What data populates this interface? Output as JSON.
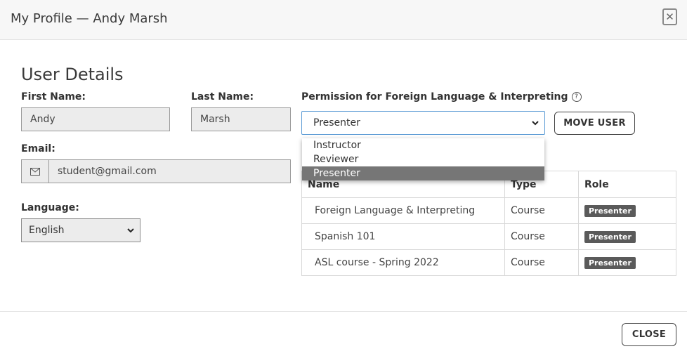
{
  "header": {
    "title": "My Profile — Andy Marsh",
    "close_glyph": "✕"
  },
  "details": {
    "title": "User Details",
    "first_name_label": "First Name:",
    "first_name": "Andy",
    "last_name_label": "Last Name:",
    "last_name": "Marsh",
    "email_label": "Email:",
    "email": "student@gmail.com",
    "language_label": "Language:",
    "language": "English"
  },
  "permission": {
    "label": "Permission for Foreign Language & Interpreting",
    "selected": "Presenter",
    "options": [
      "Instructor",
      "Reviewer",
      "Presenter"
    ],
    "move_user_label": "MOVE USER"
  },
  "table": {
    "headers": [
      "Name",
      "Type",
      "Role"
    ],
    "rows": [
      {
        "name": "Foreign Language & Interpreting",
        "type": "Course",
        "role": "Presenter"
      },
      {
        "name": "Spanish 101",
        "type": "Course",
        "role": "Presenter"
      },
      {
        "name": "ASL course - Spring 2022",
        "type": "Course",
        "role": "Presenter"
      }
    ]
  },
  "footer": {
    "close_label": "CLOSE"
  }
}
